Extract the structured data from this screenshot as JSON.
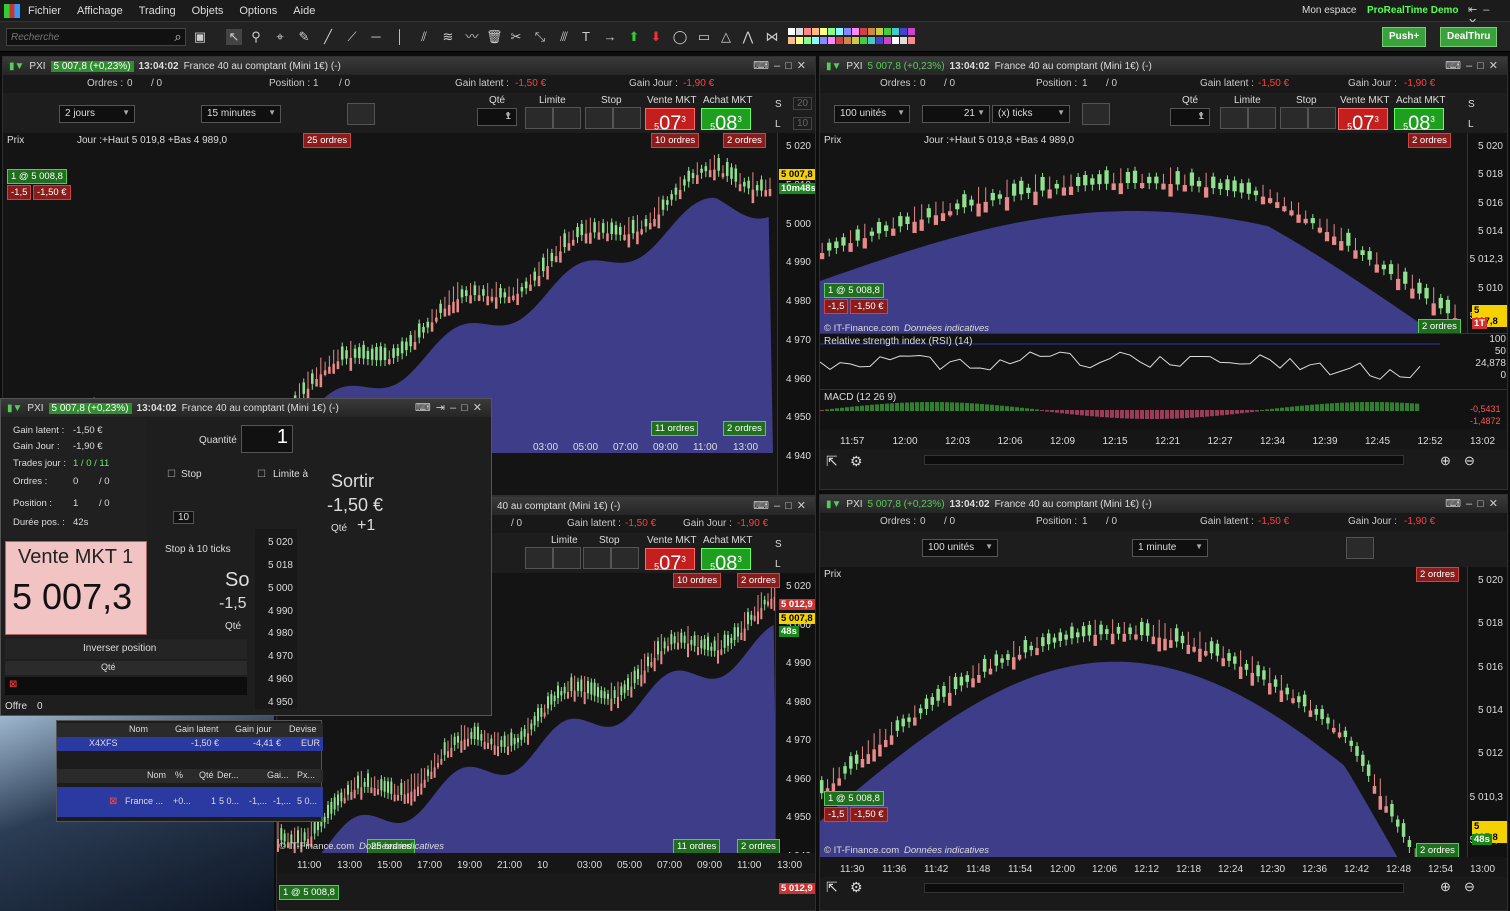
{
  "menu": [
    "Fichier",
    "Affichage",
    "Trading",
    "Objets",
    "Options",
    "Aide"
  ],
  "topright": {
    "account": "Mon espace",
    "brand": "ProRealTime Demo"
  },
  "search": {
    "placeholder": "Recherche"
  },
  "buttons": {
    "push": "Push+",
    "dealthru": "DealThru"
  },
  "header": {
    "ticker": "PXI",
    "price": "5 007,8 (+0,23%)",
    "time": "13:04:02",
    "name": "France 40 au comptant (Mini 1€) (-)"
  },
  "info": {
    "orders_lbl": "Ordres :",
    "orders_val": "0",
    "orders_val2": "/ 0",
    "position_lbl": "Position :",
    "position_val": "1",
    "position_val2": "/ 0",
    "gain_latent_lbl": "Gain latent :",
    "gain_latent": "-1,50 €",
    "gain_jour_lbl": "Gain Jour :",
    "gain_jour": "-1,90 €"
  },
  "trade": {
    "qte": "Qté",
    "limite": "Limite",
    "stop": "Stop",
    "vente": "Vente MKT",
    "achat": "Achat MKT",
    "qty": "1",
    "sell_big": "07",
    "sell_small": "5",
    "sell_sup": "3",
    "buy_big": "08",
    "buy_small": "5",
    "buy_sup": "3",
    "s": "S",
    "l": "L",
    "s_val": "20",
    "l_val": "10"
  },
  "p1": {
    "period": "2 jours",
    "interval": "15 minutes",
    "chart_label": "Prix",
    "range": "Jour :+Haut 5 019,8 +Bas 4 989,0",
    "pos_tag": "1 @ 5 008,8",
    "pnl_tag": "-1,5",
    "pnl_tag2": "-1,50 €",
    "orders25": "25 ordres",
    "orders10": "10 ordres",
    "orders2": "2 ordres",
    "orders11": "11 ordres",
    "orders2b": "2 ordres",
    "price_now": "5 007,8",
    "timer": "10m48s",
    "yticks": [
      "5 020",
      "5 010",
      "5 000",
      "4 990",
      "4 980",
      "4 970",
      "4 960",
      "4 950",
      "4 940"
    ],
    "xticks": [
      "03:00",
      "05:00",
      "07:00",
      "09:00",
      "11:00",
      "13:00"
    ]
  },
  "p2": {
    "units": "100 unités",
    "ticks": "21",
    "ticks_lbl": "(x) ticks",
    "chart_label": "Prix",
    "range": "Jour :+Haut 5 019,8 +Bas 4 989,0",
    "orders2": "2 ordres",
    "orders2b": "2 ordres",
    "pos_tag": "1 @ 5 008,8",
    "pnl_tag": "-1,5",
    "pnl_tag2": "-1,50 €",
    "copyright": "© IT-Finance.com",
    "copyright2": "Données indicatives",
    "price_now": "5 007,8",
    "tt": "1T",
    "yticks": [
      "5 020",
      "5 018",
      "5 016",
      "5 014",
      "5 012,3",
      "5 010",
      "5 007,8"
    ],
    "rsi_label": "Relative strength index (RSI) (14)",
    "rsi_ticks": [
      "100",
      "50",
      "24,878",
      "0"
    ],
    "macd_label": "MACD (12 26 9)",
    "macd_ticks": [
      "-0,5431",
      "-1,4872"
    ],
    "xticks": [
      "11:57",
      "12:00",
      "12:03",
      "12:06",
      "12:09",
      "12:15",
      "12:21",
      "12:27",
      "12:34",
      "12:39",
      "12:45",
      "12:52",
      "13:02"
    ]
  },
  "p3": {
    "units": "100 unités",
    "interval": "1 minute",
    "chart_label": "Prix",
    "orders2": "2 ordres",
    "orders2b": "2 ordres",
    "pos_tag": "1 @ 5 008,8",
    "pnl_tag": "-1,5",
    "pnl_tag2": "-1,50 €",
    "copyright": "© IT-Finance.com",
    "copyright2": "Données indicatives",
    "price_now": "5 007,8",
    "timer": "48s",
    "yticks": [
      "5 020",
      "5 018",
      "5 016",
      "5 014",
      "5 012",
      "5 010,3",
      "5 007,8"
    ],
    "xticks": [
      "11:30",
      "11:36",
      "11:42",
      "11:48",
      "11:54",
      "12:00",
      "12:06",
      "12:12",
      "12:18",
      "12:24",
      "12:30",
      "12:36",
      "12:42",
      "12:48",
      "12:54",
      "13:00"
    ]
  },
  "p4": {
    "title_part": "40 au comptant (Mini 1€) (-)",
    "orders10": "10 ordres",
    "orders2": "2 ordres",
    "orders11": "11 ordres",
    "orders2b": "2 ordres",
    "orders25": "25 ordres",
    "price_now": "5 007,8",
    "timer": "48s",
    "price_red": "5 012,9",
    "yticks": [
      "5 020",
      "5 000",
      "4 990",
      "4 980",
      "4 970",
      "4 960",
      "4 950",
      "4 940"
    ],
    "xticks": [
      "11:00",
      "13:00",
      "15:00",
      "17:00",
      "19:00",
      "21:00",
      "10",
      "03:00",
      "05:00",
      "07:00",
      "09:00",
      "11:00",
      "13:00"
    ],
    "copyright": "© IT-Finance.com",
    "copyright2": "Données indicatives",
    "pos_tag": "1 @ 5 008,8",
    "bottom_price": "5 012,9"
  },
  "ticket": {
    "gain_latent_lbl": "Gain latent :",
    "gain_latent": "-1,50 €",
    "gain_jour_lbl": "Gain Jour :",
    "gain_jour": "-1,90 €",
    "trades_lbl": "Trades jour :",
    "trades": "1 / 0 / 11",
    "ordres_lbl": "Ordres :",
    "ordres": "0",
    "ordres2": "/ 0",
    "position_lbl": "Position :",
    "position": "1",
    "position2": "/ 0",
    "duree_lbl": "Durée pos. :",
    "duree": "42s",
    "quantite_lbl": "Quantité",
    "quantite": "1",
    "stop_lbl": "Stop",
    "limite_lbl": "Limite à",
    "ticks10": "10",
    "stop_ticks": "Stop à 10 ticks",
    "sortir": "Sortir",
    "sortir_pnl": "-1,50 €",
    "qte_lbl": "Qté",
    "qte_val": "+1",
    "vente_lbl": "Vente MKT 1",
    "vente_price": "5 007,3",
    "so": "So",
    "so_pnl": "-1,5",
    "qte2": "Qté",
    "inverser": "Inverser position",
    "col_qte": "Qté",
    "offre": "Offre",
    "offre_val": "0",
    "ladder": [
      "5 020",
      "5 018",
      "5 000",
      "4 990",
      "4 980",
      "4 970",
      "4 960",
      "4 950"
    ]
  },
  "portfolio": {
    "headers": [
      "Nom",
      "Gain latent",
      "Gain jour",
      "Devise"
    ],
    "row": {
      "name": "X4XFS",
      "gl": "-1,50 €",
      "gj": "-4,41 €",
      "dev": "EUR"
    },
    "headers2": [
      "Nom",
      "%",
      "Qté",
      "Der...",
      "Gai...",
      "Px..."
    ],
    "row2": {
      "name": "France ...",
      "pct": "+0...",
      "qty": "1",
      "der": "5 0...",
      "g1": "-1,...",
      "g2": "-1,...",
      "px": "5 0..."
    }
  },
  "colors": {
    "bull": "#8fe08f",
    "bear": "#e88a8a",
    "cloud": "#4b4bb0",
    "cloud_red": "#6b1414",
    "accent": "#2f8f2f"
  }
}
